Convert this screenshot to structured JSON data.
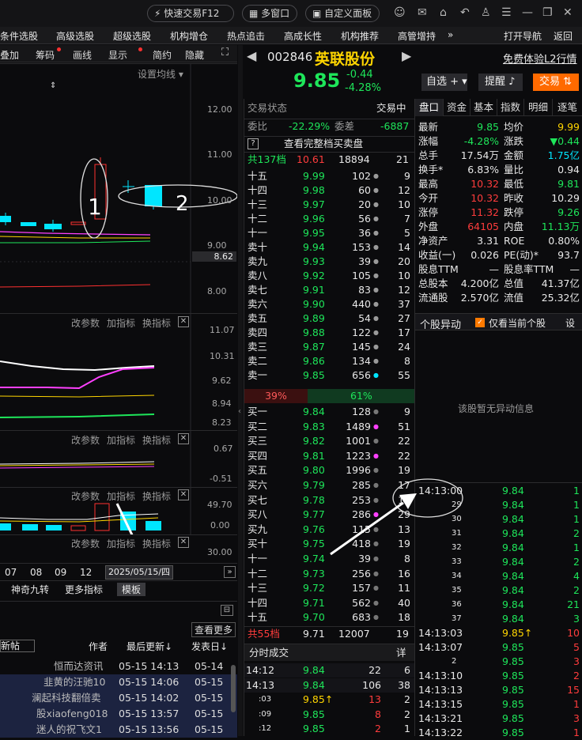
{
  "topbar": {
    "quick_trade": "快速交易F12",
    "multi_window": "多窗口",
    "custom_panel": "自定义面板"
  },
  "menu": [
    "条件选股",
    "高级选股",
    "超级选股",
    "机构增仓",
    "热点追击",
    "高成长性",
    "机构推荐",
    "高管增持",
    "»",
    "打开导航",
    "返回"
  ],
  "chart_toolbar": {
    "items": [
      "叠加",
      "筹码",
      "画线",
      "显示",
      "简约",
      "隐藏"
    ],
    "ma_setting": "设置均线"
  },
  "candle_chart": {
    "y_ticks": [
      "12.00",
      "11.00",
      "10.00",
      "9.00",
      "8.00"
    ],
    "current_price_tag": "8.62",
    "annotation_1": "1",
    "annotation_2": "2"
  },
  "indicator_panes": [
    {
      "buttons": [
        "改参数",
        "加指标",
        "换指标"
      ],
      "y_ticks": [
        "11.07",
        "10.31",
        "9.62",
        "8.94",
        "8.23"
      ]
    },
    {
      "buttons": [
        "改参数",
        "加指标",
        "换指标"
      ],
      "y_ticks": [
        "0.67",
        "-0.51"
      ]
    },
    {
      "buttons": [
        "改参数",
        "加指标",
        "换指标"
      ],
      "y_ticks": [
        "49.70",
        "0.00"
      ]
    },
    {
      "buttons": [
        "改参数",
        "加指标",
        "换指标"
      ],
      "y_ticks": [
        "30.00"
      ]
    }
  ],
  "date_axis": {
    "labels": [
      "07",
      "08",
      "09",
      "12"
    ],
    "selected_date": "2025/05/15/四"
  },
  "bottom_tabs": [
    "神奇九转",
    "更多指标",
    "模板"
  ],
  "posts": {
    "view_more": "查看更多",
    "headers": {
      "new": "新帖",
      "author": "作者",
      "last_update": "最后更新↓",
      "post_date": "发表日↓"
    },
    "rows": [
      {
        "author": "恒而达资讯",
        "update": "05-15 14:13",
        "date": "05-14"
      },
      {
        "author": "韭黄的汪驰10",
        "update": "05-15 14:06",
        "date": "05-15"
      },
      {
        "author": "澜起科技翻倍卖",
        "update": "05-15 14:02",
        "date": "05-15"
      },
      {
        "author": "股xiaofeng018",
        "update": "05-15 13:57",
        "date": "05-15"
      },
      {
        "author": "迷人的祝飞文1",
        "update": "05-15 13:56",
        "date": "05-15"
      }
    ]
  },
  "stock": {
    "code": "002846",
    "name": "英联股份",
    "l2_link": "免费体验L2行情",
    "price": "9.85",
    "change": "-0.44",
    "change_pct": "-4.28%",
    "btn_watchlist": "自选",
    "btn_alert": "提醒",
    "btn_trade": "交易"
  },
  "orderbook": {
    "status_label": "交易状态",
    "status_value": "交易中",
    "wei_bi_label": "委比",
    "wei_bi": "-22.29%",
    "wei_cha_label": "委差",
    "wei_cha": "-6887",
    "full_depth": "查看完整档买卖盘",
    "total_sell_label": "共137档",
    "total_sell_price": "10.61",
    "total_sell_vol": "18894",
    "total_sell_cnt": "21",
    "sell": [
      {
        "label": "十五",
        "price": "9.99",
        "vol": "102",
        "cnt": "9"
      },
      {
        "label": "十四",
        "price": "9.98",
        "vol": "60",
        "cnt": "12"
      },
      {
        "label": "十三",
        "price": "9.97",
        "vol": "20",
        "cnt": "10"
      },
      {
        "label": "十二",
        "price": "9.96",
        "vol": "56",
        "cnt": "7"
      },
      {
        "label": "十一",
        "price": "9.95",
        "vol": "36",
        "cnt": "5"
      },
      {
        "label": "卖十",
        "price": "9.94",
        "vol": "153",
        "cnt": "14"
      },
      {
        "label": "卖九",
        "price": "9.93",
        "vol": "39",
        "cnt": "20"
      },
      {
        "label": "卖八",
        "price": "9.92",
        "vol": "105",
        "cnt": "10"
      },
      {
        "label": "卖七",
        "price": "9.91",
        "vol": "83",
        "cnt": "12"
      },
      {
        "label": "卖六",
        "price": "9.90",
        "vol": "440",
        "cnt": "37"
      },
      {
        "label": "卖五",
        "price": "9.89",
        "vol": "54",
        "cnt": "27"
      },
      {
        "label": "卖四",
        "price": "9.88",
        "vol": "122",
        "cnt": "17"
      },
      {
        "label": "卖三",
        "price": "9.87",
        "vol": "145",
        "cnt": "24"
      },
      {
        "label": "卖二",
        "price": "9.86",
        "vol": "134",
        "cnt": "8"
      },
      {
        "label": "卖一",
        "price": "9.85",
        "vol": "656",
        "cnt": "55"
      }
    ],
    "ratio_sell": "39%",
    "ratio_buy": "61%",
    "buy": [
      {
        "label": "买一",
        "price": "9.84",
        "vol": "128",
        "cnt": "9"
      },
      {
        "label": "买二",
        "price": "9.83",
        "vol": "1489",
        "cnt": "51"
      },
      {
        "label": "买三",
        "price": "9.82",
        "vol": "1001",
        "cnt": "22"
      },
      {
        "label": "买四",
        "price": "9.81",
        "vol": "1223",
        "cnt": "22"
      },
      {
        "label": "买五",
        "price": "9.80",
        "vol": "1996",
        "cnt": "19"
      },
      {
        "label": "买六",
        "price": "9.79",
        "vol": "285",
        "cnt": "17"
      },
      {
        "label": "买七",
        "price": "9.78",
        "vol": "253",
        "cnt": "12"
      },
      {
        "label": "买八",
        "price": "9.77",
        "vol": "286",
        "cnt": "29"
      },
      {
        "label": "买九",
        "price": "9.76",
        "vol": "115",
        "cnt": "13"
      },
      {
        "label": "买十",
        "price": "9.75",
        "vol": "418",
        "cnt": "19"
      },
      {
        "label": "十一",
        "price": "9.74",
        "vol": "39",
        "cnt": "8"
      },
      {
        "label": "十二",
        "price": "9.73",
        "vol": "256",
        "cnt": "16"
      },
      {
        "label": "十三",
        "price": "9.72",
        "vol": "157",
        "cnt": "11"
      },
      {
        "label": "十四",
        "price": "9.71",
        "vol": "562",
        "cnt": "40"
      },
      {
        "label": "十五",
        "price": "9.70",
        "vol": "683",
        "cnt": "18"
      }
    ],
    "total_buy_label": "共55档",
    "total_buy_price": "9.71",
    "total_buy_vol": "12007",
    "total_buy_cnt": "19"
  },
  "time_sales_left": {
    "title": "分时成交",
    "detail": "详",
    "rows": [
      {
        "t": "14:12",
        "p": "9.84",
        "v": "22",
        "c": "6"
      },
      {
        "t": "14:13",
        "p": "9.84",
        "v": "106",
        "c": "38"
      },
      {
        "t": ":03",
        "p": "9.85↑",
        "v": "13",
        "c": "2"
      },
      {
        "t": ":09",
        "p": "9.85",
        "v": "8",
        "c": "2"
      },
      {
        "t": ":12",
        "p": "9.85",
        "v": "2",
        "c": "1"
      }
    ]
  },
  "right_tabs": [
    "盘口",
    "资金",
    "基本",
    "指数",
    "明细",
    "逐笔"
  ],
  "quote": {
    "rows": [
      {
        "l1": "最新",
        "v1": "9.85",
        "l2": "均价",
        "v2": "9.99"
      },
      {
        "l1": "涨幅",
        "v1": "-4.28%",
        "l2": "涨跌",
        "v2": "▼0.44"
      },
      {
        "l1": "总手",
        "v1": "17.54万",
        "l2": "金额",
        "v2": "1.75亿"
      },
      {
        "l1": "换手*",
        "v1": "6.83%",
        "l2": "量比",
        "v2": "0.94"
      },
      {
        "l1": "最高",
        "v1": "10.32",
        "l2": "最低",
        "v2": "9.81"
      },
      {
        "l1": "今开",
        "v1": "10.32",
        "l2": "昨收",
        "v2": "10.29"
      },
      {
        "l1": "涨停",
        "v1": "11.32",
        "l2": "跌停",
        "v2": "9.26"
      },
      {
        "l1": "外盘",
        "v1": "64105",
        "l2": "内盘",
        "v2": "11.13万"
      },
      {
        "l1": "净资产",
        "v1": "3.31",
        "l2": "ROE",
        "v2": "0.80%"
      },
      {
        "l1": "收益(一)",
        "v1": "0.026",
        "l2": "PE(动)*",
        "v2": "93.7"
      },
      {
        "l1": "股息TTM",
        "v1": "—",
        "l2": "股息率TTM",
        "v2": "—"
      },
      {
        "l1": "总股本",
        "v1": "4.200亿",
        "l2": "总值",
        "v2": "41.37亿"
      },
      {
        "l1": "流通股",
        "v1": "2.570亿",
        "l2": "流值",
        "v2": "25.32亿"
      }
    ]
  },
  "movement": {
    "title": "个股异动",
    "only_current": "仅看当前个股",
    "settings": "设",
    "empty": "该股暂无异动信息"
  },
  "tick_list": [
    {
      "t": "14:13:00",
      "p": "9.84",
      "v": "1"
    },
    {
      "t": "29",
      "p": "9.84",
      "v": "1"
    },
    {
      "t": "30",
      "p": "9.84",
      "v": "1"
    },
    {
      "t": "31",
      "p": "9.84",
      "v": "2"
    },
    {
      "t": "32",
      "p": "9.84",
      "v": "1"
    },
    {
      "t": "33",
      "p": "9.84",
      "v": "2"
    },
    {
      "t": "34",
      "p": "9.84",
      "v": "4"
    },
    {
      "t": "35",
      "p": "9.84",
      "v": "2"
    },
    {
      "t": "36",
      "p": "9.84",
      "v": "21"
    },
    {
      "t": "37",
      "p": "9.84",
      "v": "3"
    },
    {
      "t": "14:13:03",
      "p": "9.85↑",
      "v": "10"
    },
    {
      "t": "14:13:07",
      "p": "9.85",
      "v": "5"
    },
    {
      "t": "2",
      "p": "9.85",
      "v": "3"
    },
    {
      "t": "14:13:10",
      "p": "9.85",
      "v": "2"
    },
    {
      "t": "14:13:13",
      "p": "9.85",
      "v": "15"
    },
    {
      "t": "14:13:15",
      "p": "9.85",
      "v": "1"
    },
    {
      "t": "14:13:21",
      "p": "9.85",
      "v": "3"
    },
    {
      "t": "14:13:22",
      "p": "9.85",
      "v": "1"
    }
  ]
}
